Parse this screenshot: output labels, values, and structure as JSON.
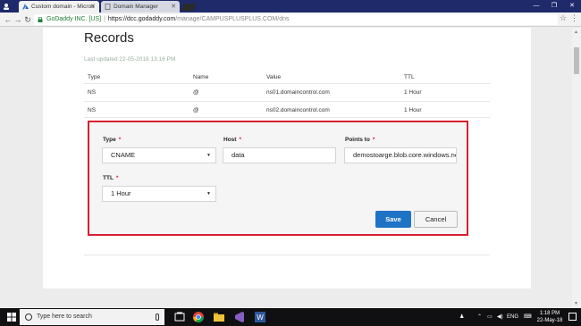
{
  "browser": {
    "tabs": [
      {
        "label": "Custom domain - Micros",
        "active": true
      },
      {
        "label": "Domain Manager",
        "active": false
      }
    ],
    "address": {
      "site_identity": "GoDaddy INC. [US]",
      "separator": "|",
      "url_scheme_host": "https://dcc.godaddy.com",
      "url_path": "/manage/CAMPUSPLUSPLUS.COM/dns"
    }
  },
  "records": {
    "title": "Records",
    "last_updated": "Last updated 22-05-2018 13:16 PM",
    "columns": [
      "Type",
      "Name",
      "Value",
      "TTL"
    ],
    "rows": [
      {
        "type": "NS",
        "name": "@",
        "value": "ns01.domaincontrol.com",
        "ttl": "1 Hour"
      },
      {
        "type": "NS",
        "name": "@",
        "value": "ns02.domaincontrol.com",
        "ttl": "1 Hour"
      }
    ]
  },
  "edit_form": {
    "type_label": "Type",
    "type_value": "CNAME",
    "host_label": "Host",
    "host_value": "data",
    "points_label": "Points to",
    "points_value": "demostoarge.blob.core.windows.net",
    "ttl_label": "TTL",
    "ttl_value": "1 Hour",
    "required_marker": "*",
    "save_label": "Save",
    "cancel_label": "Cancel",
    "highlight_color": "#d62030",
    "primary_color": "#1f73c6"
  },
  "taskbar": {
    "search_placeholder": "Type here to search",
    "language": "ENG",
    "time": "1:18 PM",
    "date": "22-May-18"
  }
}
